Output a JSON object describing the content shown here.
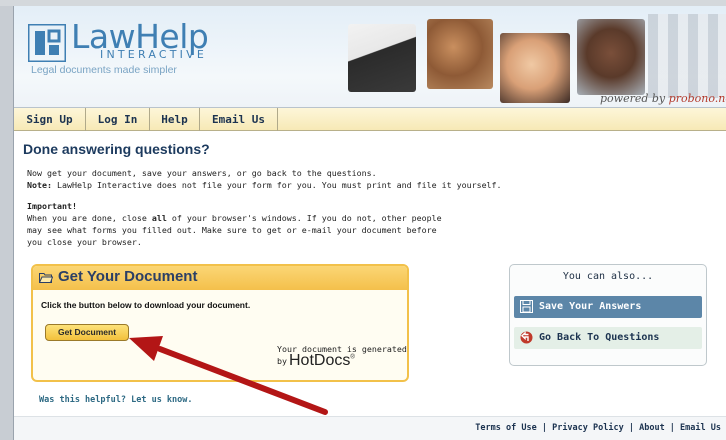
{
  "header": {
    "logo_word": "LawHelp",
    "logo_sub": "INTERACTIVE",
    "tagline": "Legal documents made simpler",
    "powered_prefix": "powered by",
    "powered_brand": "probono.net"
  },
  "nav": {
    "items": [
      {
        "label": "Sign Up"
      },
      {
        "label": "Log In"
      },
      {
        "label": "Help"
      },
      {
        "label": "Email Us"
      }
    ]
  },
  "main": {
    "title": "Done answering questions?",
    "line1": "Now get your document, save your answers, or go back to the questions.",
    "note_label": "Note:",
    "note_text": " LawHelp Interactive does not file your form for you. You must print and file it yourself.",
    "important_label": "Important!",
    "imp1_a": "When you are done, close ",
    "imp1_b": "all",
    "imp1_c": " of your browser's windows. If you do not, other people",
    "imp2": "may see what forms you filled out. Make sure to get or e-mail your document before",
    "imp3": "you close your browser."
  },
  "get_document": {
    "title": "Get Your Document",
    "instruction": "Click the button below to download your document.",
    "button_label": "Get Document",
    "generated_text": "Your document is generated",
    "by_text": "by",
    "hotdocs": "HotDocs",
    "reg": "®"
  },
  "side_box": {
    "title": "You can also...",
    "save_label": "Save Your Answers",
    "back_label": "Go Back To Questions"
  },
  "helpful": "Was this helpful? Let us know.",
  "footer": {
    "terms": "Terms of Use",
    "privacy": "Privacy Policy",
    "about": "About",
    "email": "Email Us",
    "sep": " | "
  },
  "colors": {
    "brand_blue": "#3f7fb3",
    "heading_navy": "#1c3a5e",
    "gold": "#f4c04b",
    "arrow_red": "#b31616"
  }
}
